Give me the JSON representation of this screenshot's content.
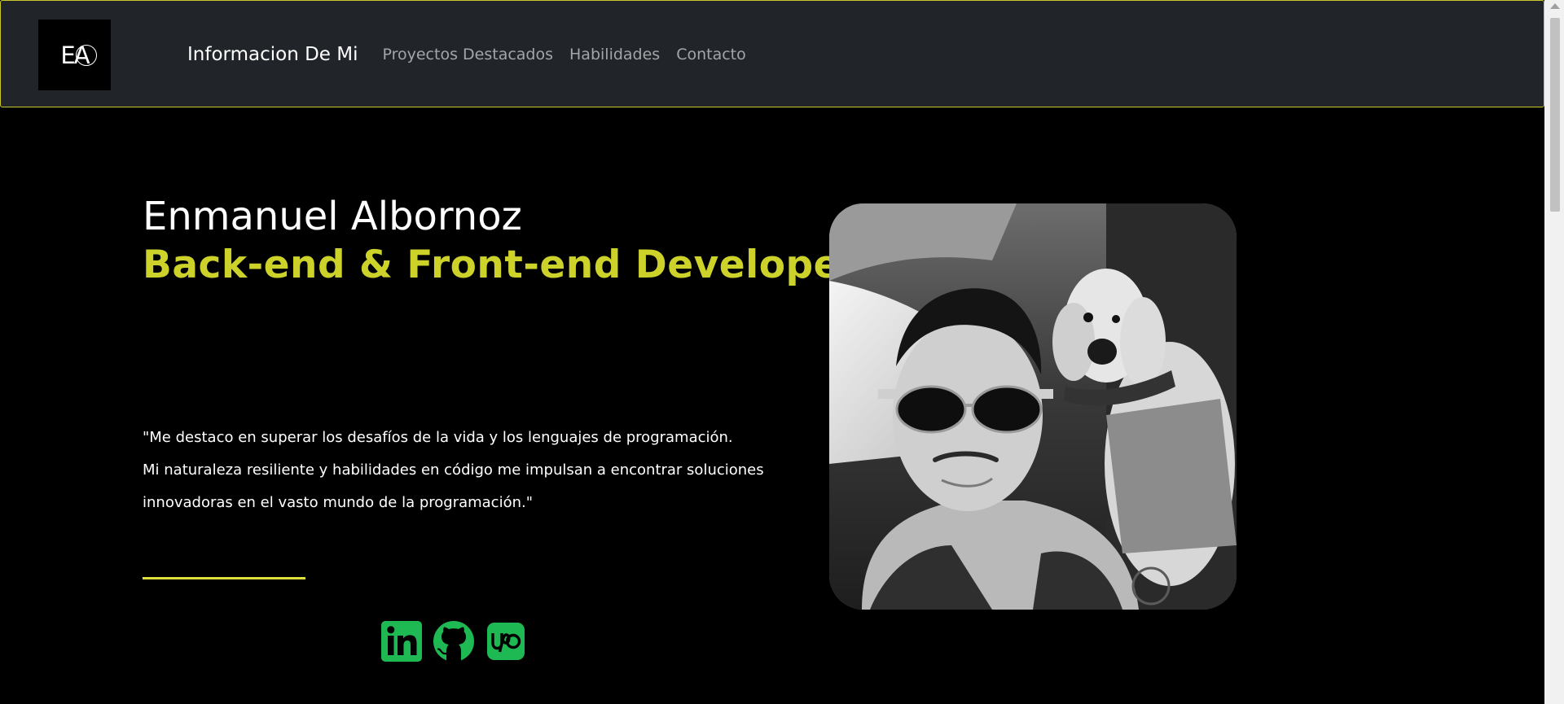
{
  "nav": {
    "logo": "EA",
    "items": [
      {
        "label": "Informacion De Mi"
      },
      {
        "label": "Proyectos Destacados"
      },
      {
        "label": "Habilidades"
      },
      {
        "label": "Contacto"
      }
    ]
  },
  "hero": {
    "name": "Enmanuel Albornoz",
    "role": "Back-end & Front-end Developer",
    "quote_lines": [
      "\"Me destaco en superar los desafíos de la vida y los lenguajes de programación.",
      "Mi naturaleza resiliente y habilidades en código me impulsan a encontrar soluciones",
      "innovadoras en el vasto mundo de la programación.\""
    ]
  },
  "socials": [
    {
      "icon": "linkedin-icon",
      "color": "#1fb954"
    },
    {
      "icon": "github-icon",
      "color": "#1fb954"
    },
    {
      "icon": "upwork-icon",
      "color": "#1fb954"
    }
  ],
  "colors": {
    "accent": "#cdd22a",
    "navbar_bg": "#212529",
    "navbar_border": "#c9c92a",
    "social_green": "#1fb954"
  }
}
